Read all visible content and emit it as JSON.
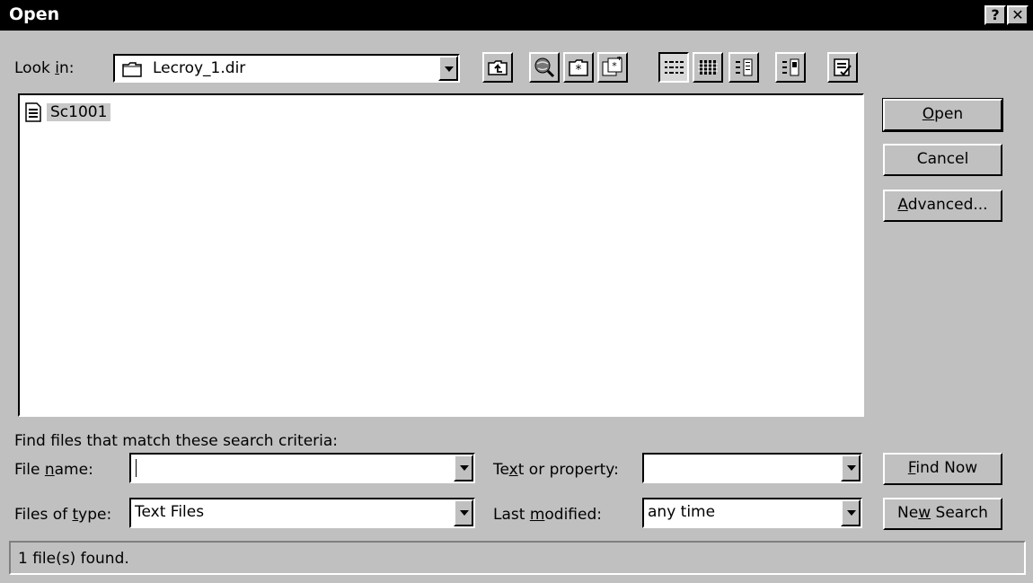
{
  "window": {
    "title": "Open",
    "help_label": "?",
    "close_label": "✕"
  },
  "look_in": {
    "label": "Look in:",
    "value": "Lecroy_1.dir"
  },
  "toolbar": {
    "icons": [
      "up-folder-icon",
      "search-web-icon",
      "add-favorites-icon",
      "look-in-favorites-icon",
      "list-view-icon",
      "details-view-icon",
      "properties-view-icon",
      "preview-view-icon",
      "commands-settings-icon"
    ]
  },
  "files": [
    {
      "name": "Sc1001",
      "icon": "text-file-icon"
    }
  ],
  "buttons": {
    "open": "Open",
    "cancel": "Cancel",
    "advanced": "Advanced...",
    "find_now": "Find Now",
    "new_search": "New Search"
  },
  "search": {
    "criteria_label": "Find files that match these search criteria:",
    "file_name_label": "File name:",
    "file_name_value": "",
    "files_of_type_label": "Files of type:",
    "files_of_type_value": "Text Files",
    "text_property_label": "Text or property:",
    "text_property_value": "",
    "last_modified_label": "Last modified:",
    "last_modified_value": "any time"
  },
  "status": {
    "text": "1 file(s) found."
  }
}
